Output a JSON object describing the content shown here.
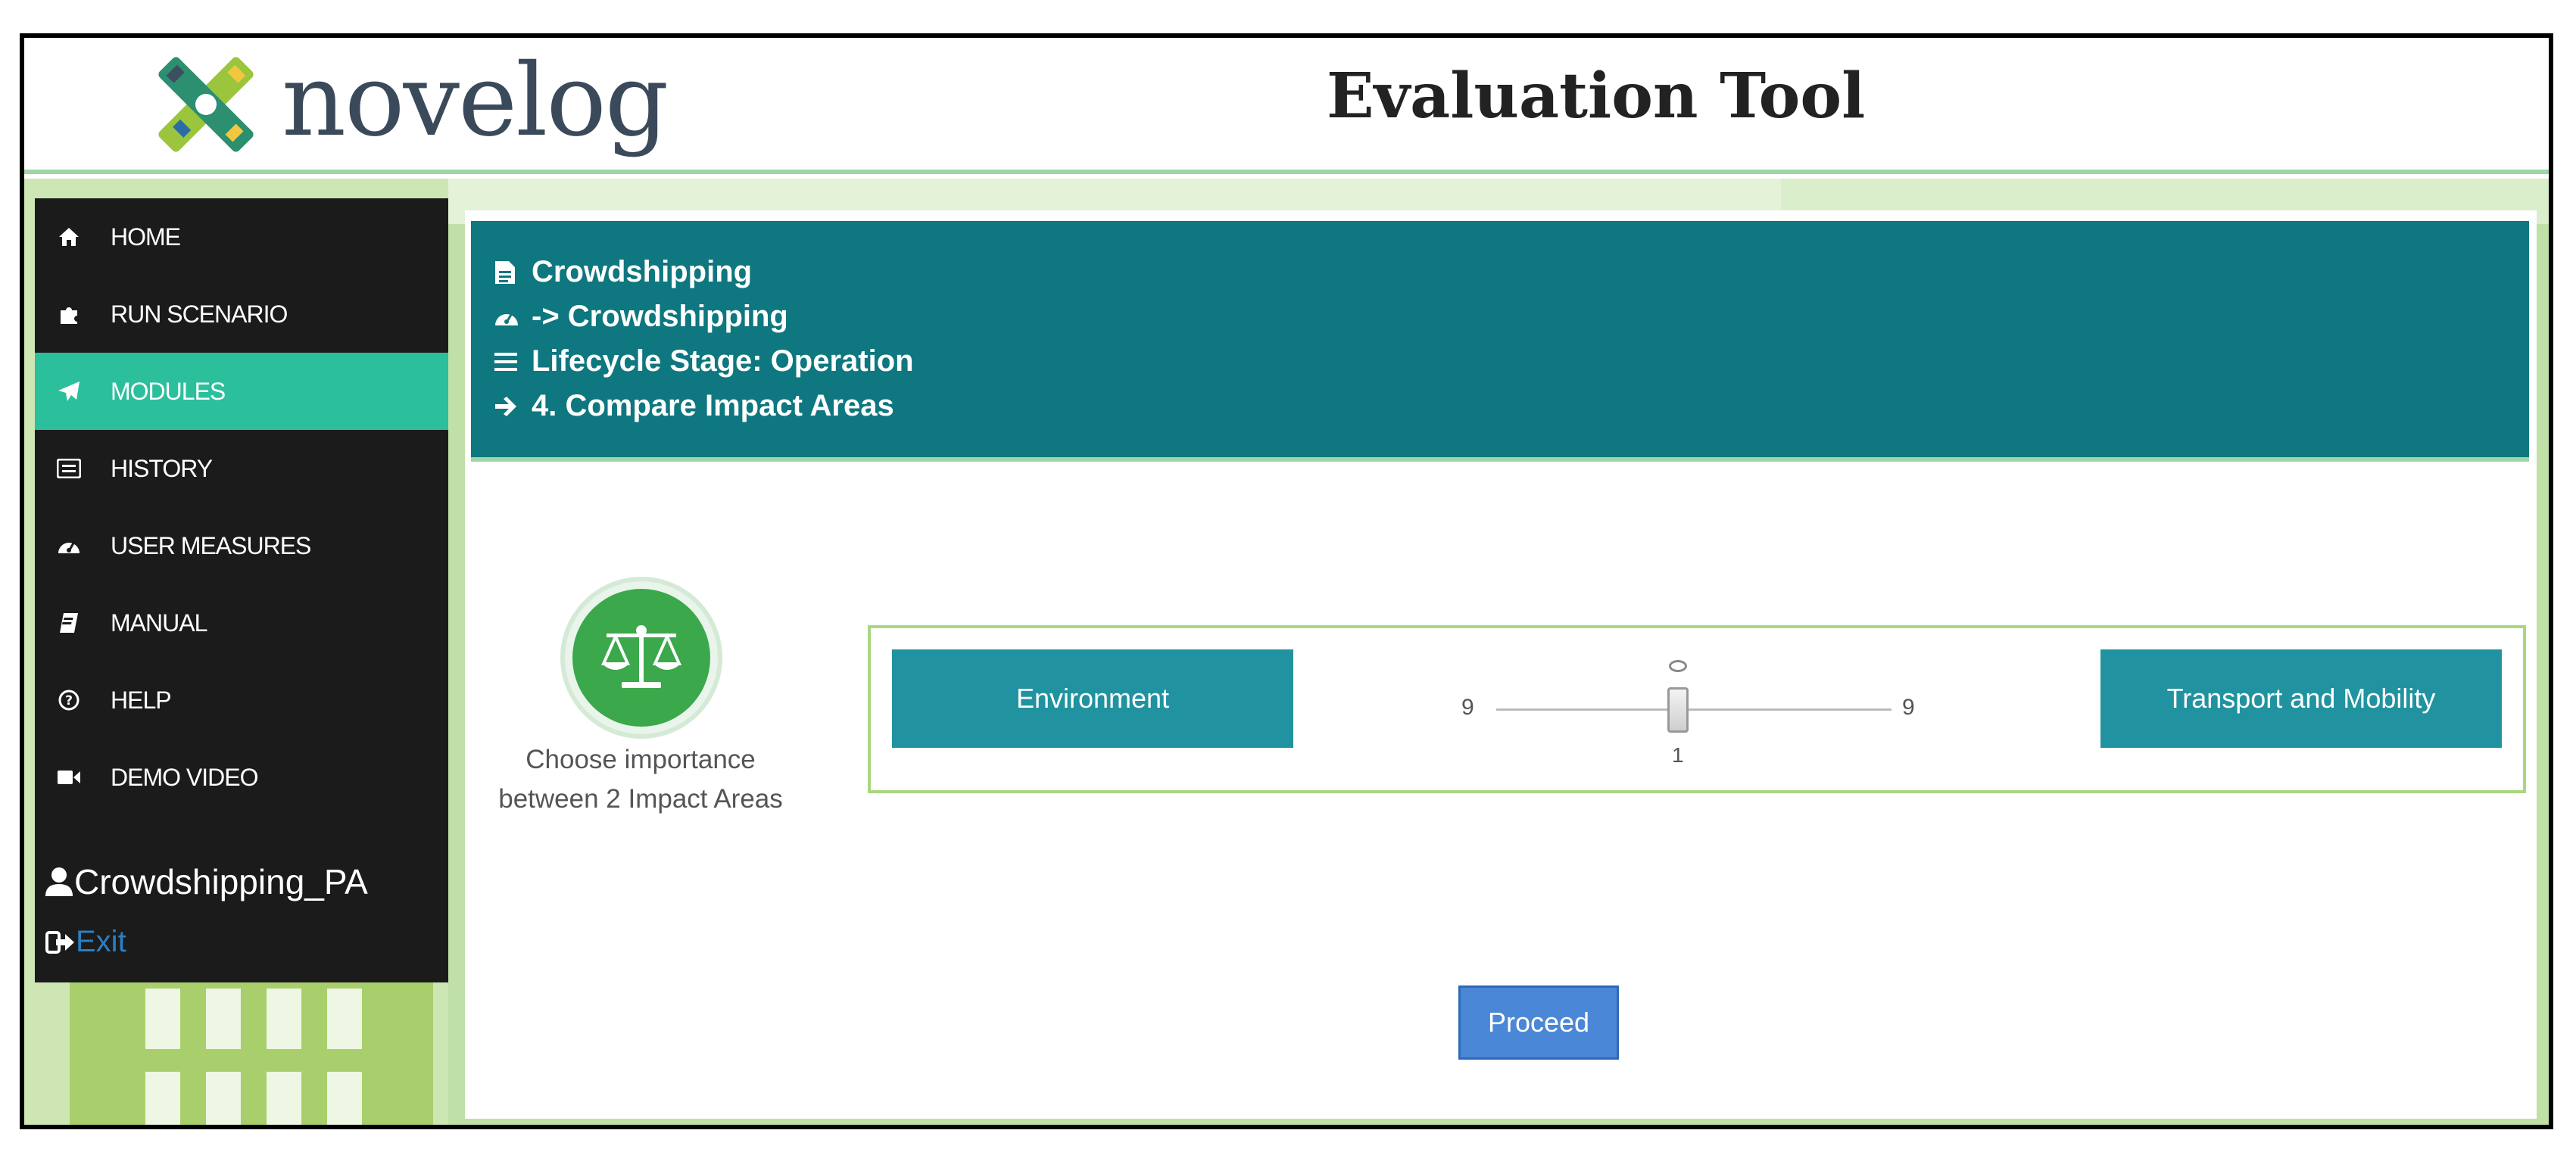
{
  "header": {
    "logo_text": "novelog",
    "title": "Evaluation Tool"
  },
  "sidebar": {
    "items": [
      {
        "label": "HOME",
        "icon": "home-icon"
      },
      {
        "label": "RUN SCENARIO",
        "icon": "puzzle-icon"
      },
      {
        "label": "MODULES",
        "icon": "paper-plane-icon",
        "active": true
      },
      {
        "label": "HISTORY",
        "icon": "list-icon"
      },
      {
        "label": "USER MEASURES",
        "icon": "dashboard-icon"
      },
      {
        "label": "MANUAL",
        "icon": "book-icon"
      },
      {
        "label": "HELP",
        "icon": "question-icon"
      },
      {
        "label": "DEMO VIDEO",
        "icon": "video-camera-icon"
      }
    ],
    "user": "Crowdshipping_PA",
    "exit": "Exit"
  },
  "breadcrumb": {
    "lines": [
      {
        "text": "Crowdshipping",
        "icon": "file-text-icon"
      },
      {
        "text": "-> Crowdshipping",
        "icon": "dashboard-icon"
      },
      {
        "text": "Lifecycle Stage: Operation",
        "icon": "bars-icon"
      },
      {
        "text": "4. Compare Impact Areas",
        "icon": "arrow-right-icon"
      }
    ]
  },
  "compare": {
    "description": "Choose importance between 2 Impact Areas",
    "left_area": "Environment",
    "right_area": "Transport and Mobility",
    "slider": {
      "min_label": "9",
      "max_label": "9",
      "value_label": "1",
      "value": 1
    }
  },
  "actions": {
    "proceed": "Proceed"
  },
  "colors": {
    "sidebar_bg": "#1b1b1b",
    "active_item": "#2cbf9c",
    "breadcrumb_bg": "#0e777f",
    "area_button": "#2193a0",
    "proceed_button": "#4a87d6",
    "accent_green": "#3aa84b"
  }
}
